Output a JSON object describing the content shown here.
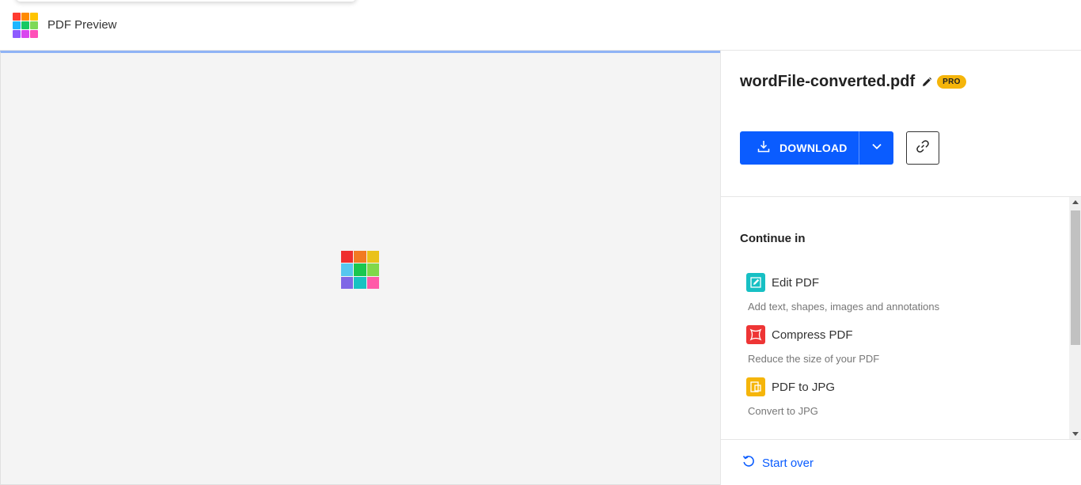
{
  "header": {
    "app_title": "PDF Preview",
    "logo_colors": [
      "#ff3b30",
      "#ff8a00",
      "#ffc400",
      "#1fb6ff",
      "#17c964",
      "#7ed957",
      "#8e5cff",
      "#d946ef",
      "#ff4fb8"
    ]
  },
  "preview": {
    "loader_colors": [
      "#ef2f2f",
      "#f27a22",
      "#eac21a",
      "#56c7ef",
      "#1ac74f",
      "#80d84a",
      "#7f67e6",
      "#18c2c2",
      "#ff5aa8"
    ]
  },
  "file": {
    "name": "wordFile-converted.pdf",
    "badge": "PRO",
    "edit_icon": "pencil-icon"
  },
  "actions": {
    "download_label": "DOWNLOAD",
    "download_icon": "download-icon",
    "dropdown_icon": "chevron-down-icon",
    "link_icon": "link-icon",
    "accent_color": "#0a5cff"
  },
  "continue": {
    "title": "Continue in",
    "tools": [
      {
        "name": "Edit PDF",
        "description": "Add text, shapes, images and annotations",
        "icon": "edit-pdf-icon",
        "color": "#17c0c4"
      },
      {
        "name": "Compress PDF",
        "description": "Reduce the size of your PDF",
        "icon": "compress-pdf-icon",
        "color": "#ee3535"
      },
      {
        "name": "PDF to JPG",
        "description": "Convert to JPG",
        "icon": "pdf-to-jpg-icon",
        "color": "#f5b50a"
      }
    ]
  },
  "footer": {
    "start_over_label": "Start over",
    "start_over_icon": "undo-icon"
  }
}
